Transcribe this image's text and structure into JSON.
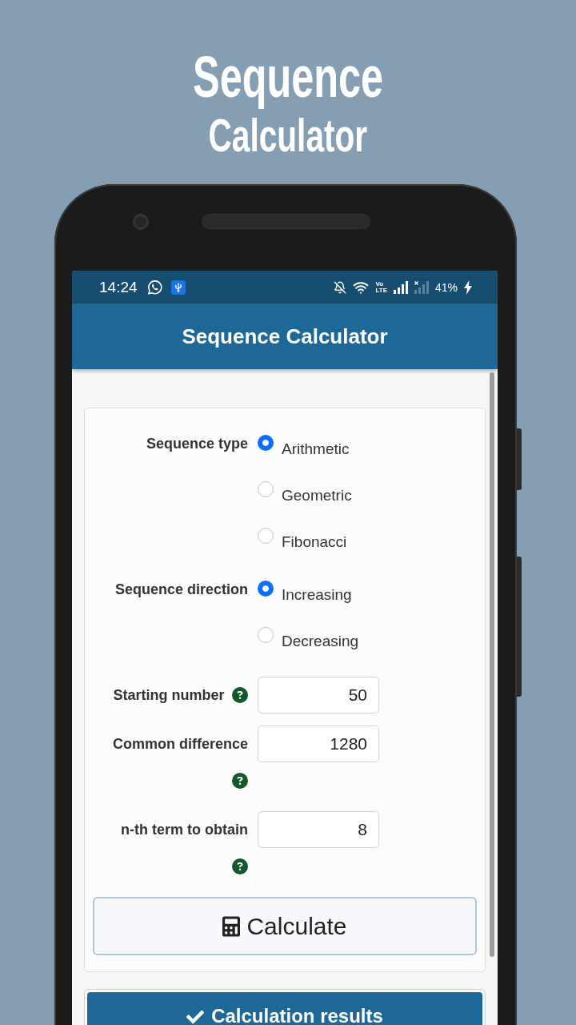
{
  "headline": {
    "title": "Sequence",
    "subtitle": "Calculator"
  },
  "status_bar": {
    "time": "14:24",
    "network": [
      "Vo",
      "LTE"
    ],
    "battery": "41%",
    "charging": true
  },
  "app_bar": {
    "title": "Sequence Calculator"
  },
  "form": {
    "fields": [
      {
        "kind": "radio",
        "label": "Sequence type",
        "options": [
          {
            "label": "Arithmetic",
            "selected": true
          },
          {
            "label": "Geometric",
            "selected": false
          },
          {
            "label": "Fibonacci",
            "selected": false
          }
        ]
      },
      {
        "kind": "radio",
        "label": "Sequence direction",
        "options": [
          {
            "label": "Increasing",
            "selected": true
          },
          {
            "label": "Decreasing",
            "selected": false
          }
        ]
      },
      {
        "kind": "number",
        "label": "Starting number",
        "value": "50",
        "help": true
      },
      {
        "kind": "number",
        "label": "Common difference",
        "value": "1280",
        "help": true
      },
      {
        "kind": "number",
        "label": "n-th term to obtain",
        "value": "8",
        "help": true
      }
    ]
  },
  "calculate_button": {
    "label": "Calculate"
  },
  "results_button": {
    "label": "Calculation results"
  }
}
